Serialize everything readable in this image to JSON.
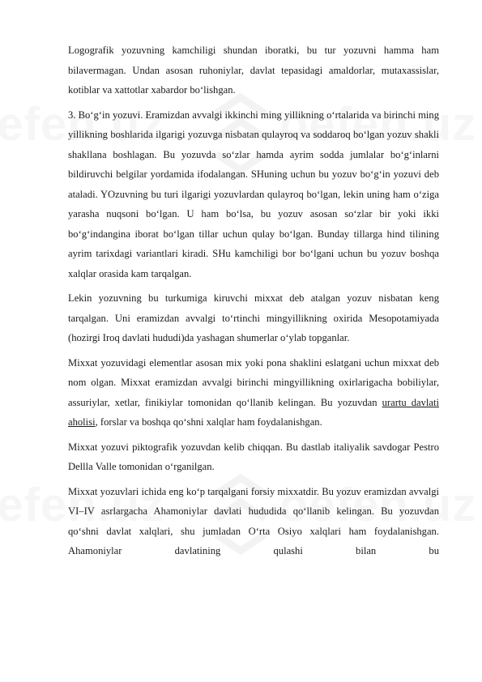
{
  "watermark": {
    "text": "oefen.uz"
  },
  "paragraphs": [
    {
      "text": "Logografik yozuvning kamchiligi shundan iboratki, bu tur yozuvni hamma ham bilavermagan. Undan asosan ruhoniylar, davlat tepasidagi amaldorlar, mutaxassislar, kotiblar va xattotlar xabardor bo‘lishgan."
    },
    {
      "text": "3. Bo‘g‘in yozuvi. Eramizdan avvalgi ikkinchi ming yillikning o‘rtalarida va birinchi ming yillikning boshlarida ilgarigi yozuvga nisbatan qulayroq va soddaroq bo‘lgan yozuv shakli shakllana boshlagan. Bu yozuvda so‘zlar hamda ayrim sodda jumlalar bo‘g‘inlarni bildiruvchi belgilar yordamida ifodalangan. SHuning uchun bu yozuv bo‘g‘in yozuvi deb ataladi. YOzuvning bu turi ilgarigi yozuvlardan qulayroq bo‘lgan, lekin uning ham o‘ziga yarasha nuqsoni bo‘lgan. U ham bo‘lsa, bu yozuv asosan so‘zlar bir yoki ikki bo‘g‘indangina iborat bo‘lgan tillar uchun qulay bo‘lgan. Bunday tillarga hind tilining ayrim tarixdagi variantlari kiradi. SHu kamchiligi bor bo‘lgani uchun bu yozuv boshqa xalqlar orasida kam tarqalgan."
    },
    {
      "text": "Lekin yozuvning bu turkumiga kiruvchi mixxat deb atalgan yozuv nisbatan keng tarqalgan. Uni eramizdan avvalgi to‘rtinchi mingyillikning oxirida Mesopotamiyada (hozirgi Iroq davlati hududi)da yashagan shumerlar o‘ylab topganlar."
    },
    {
      "before": "Mixxat yozuvidagi elementlar asosan mix yoki pona shaklini eslatgani uchun mixxat deb nom olgan. Mixxat eramizdan avvalgi birinchi mingyillikning oxirlarigacha bobiliylar, assuriylar, xetlar, finikiylar tomonidan qo‘llanib kelingan. Bu yozuvdan ",
      "link": "urartu davlati aholisi",
      "after": ", forslar va boshqa qo‘shni xalqlar ham foydalanishgan."
    },
    {
      "text": "Mixxat yozuvi piktografik yozuvdan kelib chiqqan. Bu dastlab italiyalik savdogar Pestro Dellla Valle tomonidan o‘rganilgan."
    },
    {
      "text": "Mixxat yozuvlari ichida eng ko‘p tarqalgani forsiy mixxatdir. Bu yozuv eramizdan avvalgi VI–IV asrlargacha Ahamoniylar davlati hududida qo‘llanib kelingan. Bu yozuvdan qo‘shni davlat xalqlari, shu jumladan O‘rta Osiyo xalqlari ham foydalanishgan. Ahamoniylar davlatining qulashi bilan bu"
    }
  ]
}
